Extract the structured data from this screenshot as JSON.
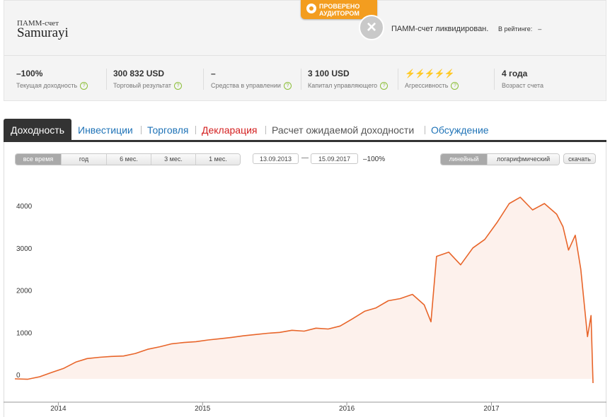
{
  "account": {
    "type_label": "ПАММ-счет",
    "name": "Samurayi",
    "badge_line1": "ПРОВЕРЕНО",
    "badge_line2": "АУДИТОРОМ",
    "status_text": "ПАММ-счет ликвидирован.",
    "rating_label": "В рейтинге:",
    "rating_value": "–"
  },
  "stats": [
    {
      "value": "–100%",
      "label": "Текущая доходность"
    },
    {
      "value": "300 832 USD",
      "label": "Торговый результат"
    },
    {
      "value": "–",
      "label": "Средства в управлении"
    },
    {
      "value": "3 100 USD",
      "label": "Капитал управляющего"
    },
    {
      "value": "⚡⚡⚡⚡⚡",
      "label": "Агрессивность"
    },
    {
      "value": "4 года",
      "label": "Возраст счета"
    }
  ],
  "help_glyph": "?",
  "tabs": [
    {
      "label": "Доходность"
    },
    {
      "label": "Инвестиции"
    },
    {
      "label": "Торговля"
    },
    {
      "label": "Декларация"
    },
    {
      "label": "Расчет ожидаемой доходности"
    },
    {
      "label": "Обсуждение"
    }
  ],
  "controls": {
    "periods": [
      "все время",
      "год",
      "6 мес.",
      "3 мес.",
      "1 мес."
    ],
    "date_from": "13.09.2013",
    "date_dash": "—",
    "date_to": "15.09.2017",
    "range_value": "–100%",
    "scales": [
      "линейный",
      "логарифмический"
    ],
    "download": "скачать"
  },
  "colors": {
    "line": "#e8652a",
    "fill": "#fdf1ec",
    "accent_blue": "#1f73b7",
    "accent_red": "#d42020"
  },
  "chart_data": {
    "type": "area",
    "y_ticks": [
      "0",
      "1000",
      "2000",
      "3000",
      "4000"
    ],
    "x_ticks": [
      "2014",
      "2015",
      "2016",
      "2017"
    ],
    "ylim": [
      -100,
      4400
    ],
    "series": [
      {
        "x": [
          "2013-09-13",
          "2013-10-15",
          "2013-11-15",
          "2013-12-15",
          "2014-01-15",
          "2014-02-15",
          "2014-03-15",
          "2014-04-15",
          "2014-05-15",
          "2014-06-15",
          "2014-07-15",
          "2014-08-15",
          "2014-09-15",
          "2014-10-15",
          "2014-11-15",
          "2014-12-15",
          "2015-01-15",
          "2015-02-15",
          "2015-03-15",
          "2015-04-15",
          "2015-05-15",
          "2015-06-15",
          "2015-07-15",
          "2015-08-15",
          "2015-09-15",
          "2015-10-15",
          "2015-11-15",
          "2015-12-15",
          "2016-01-15",
          "2016-02-15",
          "2016-03-15",
          "2016-04-15",
          "2016-05-15",
          "2016-06-15",
          "2016-07-15",
          "2016-08-01",
          "2016-08-15",
          "2016-09-15",
          "2016-10-15",
          "2016-11-15",
          "2016-12-15",
          "2017-01-15",
          "2017-02-15",
          "2017-03-15",
          "2017-04-15",
          "2017-05-15",
          "2017-06-15",
          "2017-07-01",
          "2017-07-15",
          "2017-08-01",
          "2017-08-15",
          "2017-09-01",
          "2017-09-10",
          "2017-09-15"
        ],
        "y": [
          0,
          -10,
          50,
          150,
          250,
          400,
          480,
          510,
          530,
          540,
          600,
          700,
          760,
          830,
          860,
          880,
          920,
          950,
          980,
          1020,
          1050,
          1080,
          1100,
          1150,
          1130,
          1200,
          1180,
          1250,
          1420,
          1600,
          1680,
          1850,
          1900,
          2000,
          1750,
          1350,
          2900,
          3000,
          2700,
          3100,
          3300,
          3700,
          4150,
          4300,
          4000,
          4150,
          3900,
          3600,
          3050,
          3400,
          2600,
          1000,
          1500,
          -100
        ]
      }
    ]
  }
}
